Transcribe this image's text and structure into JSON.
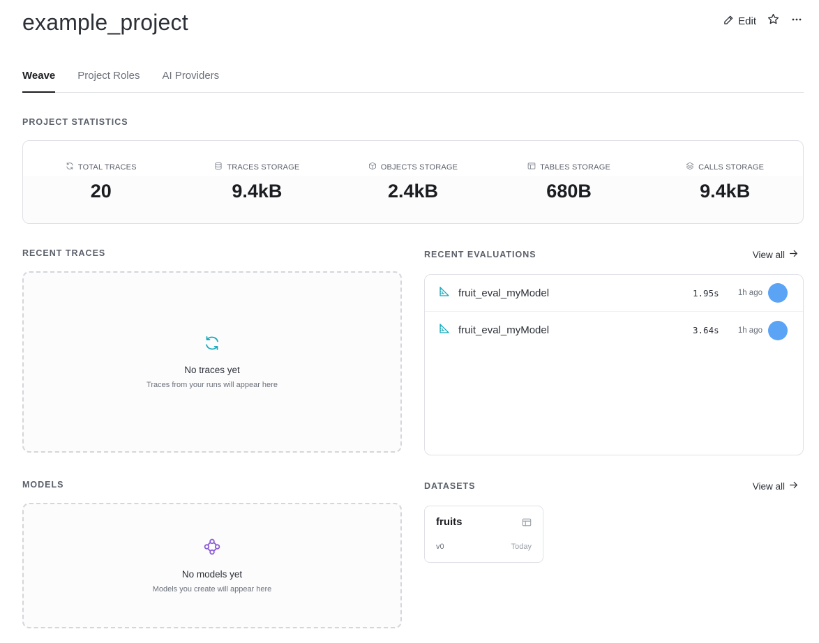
{
  "header": {
    "title": "example_project",
    "edit_label": "Edit"
  },
  "tabs": [
    {
      "label": "Weave",
      "active": true
    },
    {
      "label": "Project Roles",
      "active": false
    },
    {
      "label": "AI Providers",
      "active": false
    }
  ],
  "stats": {
    "section_label": "PROJECT STATISTICS",
    "items": [
      {
        "label": "TOTAL TRACES",
        "value": "20",
        "icon": "refresh-icon"
      },
      {
        "label": "TRACES STORAGE",
        "value": "9.4kB",
        "icon": "database-icon"
      },
      {
        "label": "OBJECTS STORAGE",
        "value": "2.4kB",
        "icon": "cube-icon"
      },
      {
        "label": "TABLES STORAGE",
        "value": "680B",
        "icon": "table-icon"
      },
      {
        "label": "CALLS STORAGE",
        "value": "9.4kB",
        "icon": "layers-icon"
      }
    ]
  },
  "recent_traces": {
    "section_label": "RECENT TRACES",
    "empty_title": "No traces yet",
    "empty_sub": "Traces from your runs will appear here"
  },
  "recent_evaluations": {
    "section_label": "RECENT EVALUATIONS",
    "view_all": "View all",
    "rows": [
      {
        "name": "fruit_eval_myModel",
        "duration": "1.95s",
        "time": "1h ago"
      },
      {
        "name": "fruit_eval_myModel",
        "duration": "3.64s",
        "time": "1h ago"
      }
    ]
  },
  "models": {
    "section_label": "MODELS",
    "empty_title": "No models yet",
    "empty_sub": "Models you create will appear here"
  },
  "datasets": {
    "section_label": "DATASETS",
    "view_all": "View all",
    "items": [
      {
        "name": "fruits",
        "version": "v0",
        "date": "Today"
      }
    ]
  },
  "colors": {
    "accent_teal": "#13a9ba",
    "accent_purple": "#8c5dd6",
    "avatar_blue": "#5ba3f5"
  }
}
